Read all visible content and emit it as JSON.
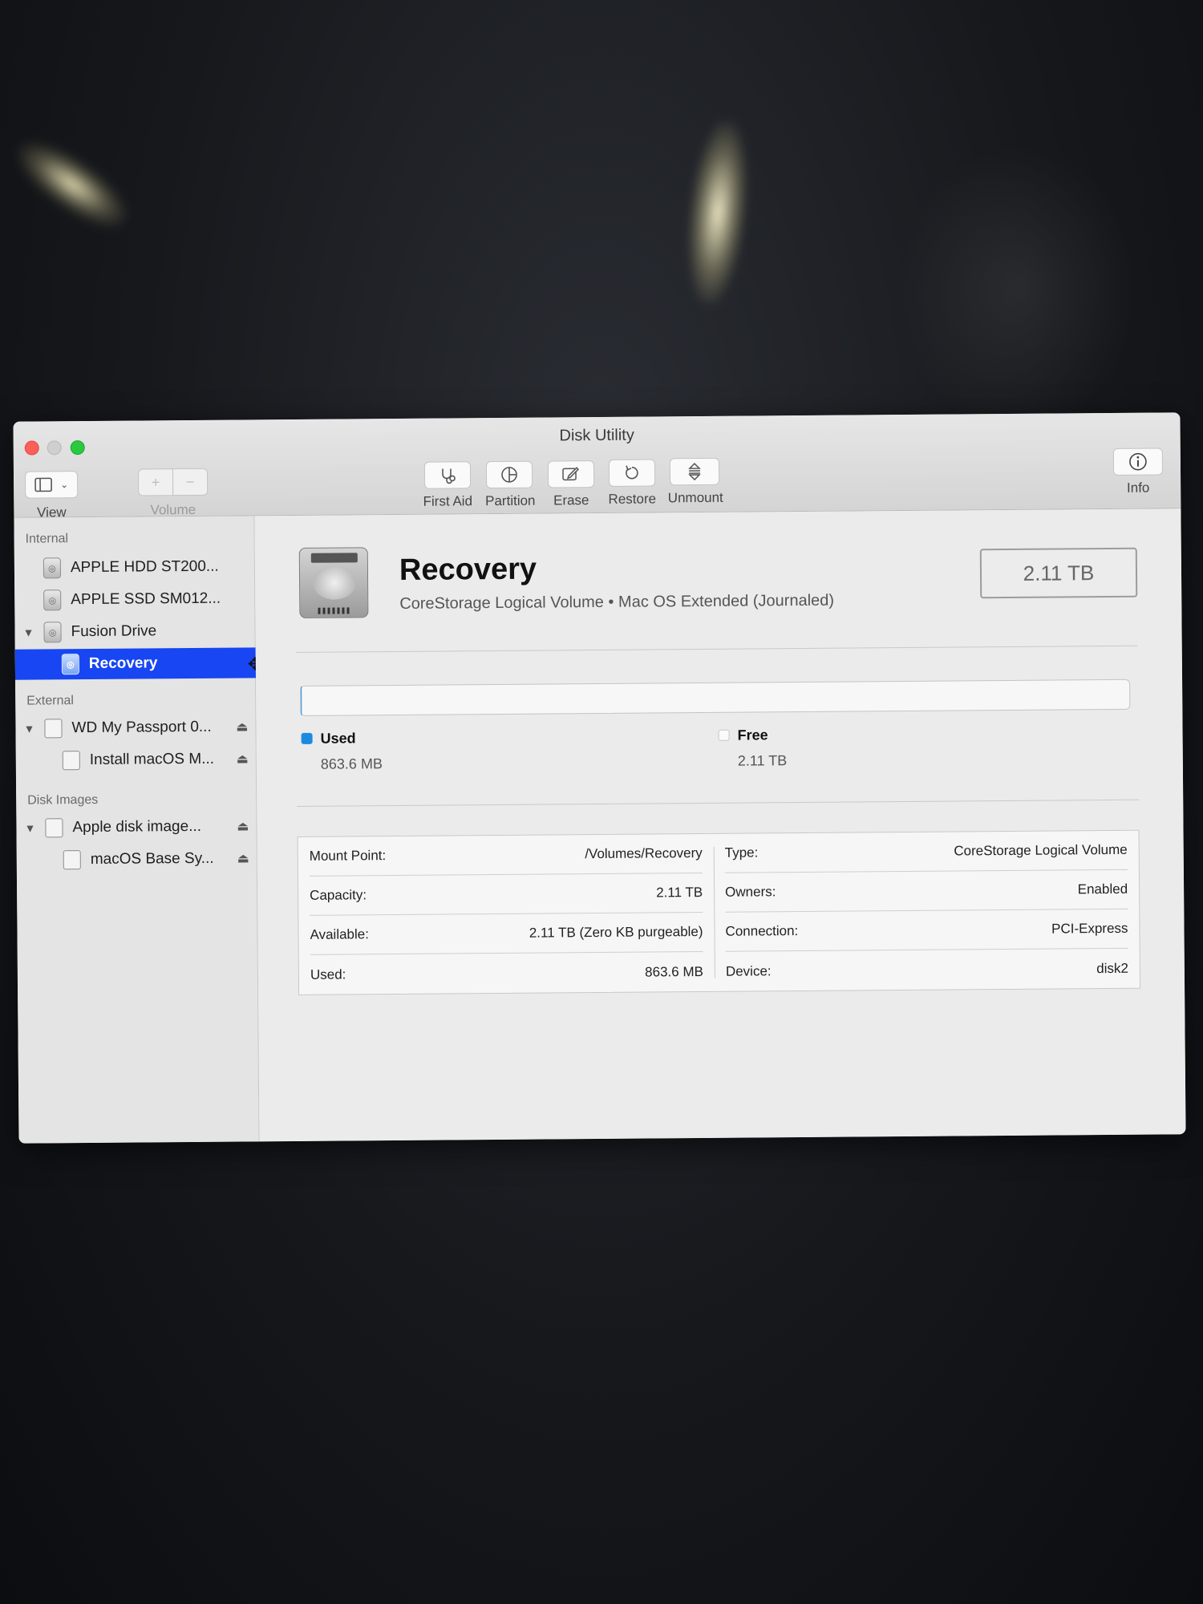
{
  "window": {
    "title": "Disk Utility"
  },
  "toolbar": {
    "view_label": "View",
    "volume_label": "Volume",
    "add_glyph": "+",
    "remove_glyph": "−",
    "first_aid_label": "First Aid",
    "partition_label": "Partition",
    "erase_label": "Erase",
    "restore_label": "Restore",
    "unmount_label": "Unmount",
    "info_label": "Info"
  },
  "sidebar": {
    "internal_header": "Internal",
    "external_header": "External",
    "images_header": "Disk Images",
    "items": [
      {
        "label": "APPLE HDD ST200..."
      },
      {
        "label": "APPLE SSD SM012..."
      },
      {
        "label": "Fusion Drive"
      },
      {
        "label": "Recovery"
      },
      {
        "label": "WD My Passport 0..."
      },
      {
        "label": "Install macOS M..."
      },
      {
        "label": "Apple disk image..."
      },
      {
        "label": "macOS Base Sy..."
      }
    ]
  },
  "volume": {
    "name": "Recovery",
    "subtitle": "CoreStorage Logical Volume • Mac OS Extended (Journaled)",
    "size": "2.11 TB"
  },
  "usage": {
    "used_label": "Used",
    "used_value": "863.6 MB",
    "free_label": "Free",
    "free_value": "2.11 TB",
    "used_fraction": 0.0004,
    "used_color": "#1b8be0"
  },
  "details": {
    "left": [
      {
        "label": "Mount Point:",
        "value": "/Volumes/Recovery"
      },
      {
        "label": "Capacity:",
        "value": "2.11 TB"
      },
      {
        "label": "Available:",
        "value": "2.11 TB (Zero KB purgeable)"
      },
      {
        "label": "Used:",
        "value": "863.6 MB"
      }
    ],
    "right": [
      {
        "label": "Type:",
        "value": "CoreStorage Logical Volume"
      },
      {
        "label": "Owners:",
        "value": "Enabled"
      },
      {
        "label": "Connection:",
        "value": "PCI-Express"
      },
      {
        "label": "Device:",
        "value": "disk2"
      }
    ]
  }
}
